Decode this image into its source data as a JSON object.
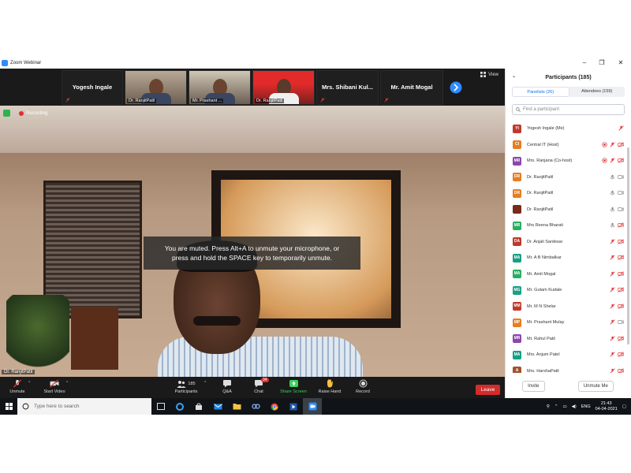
{
  "window": {
    "title": "Zoom Webinar",
    "min": "–",
    "max": "❐",
    "close": "✕"
  },
  "strip": {
    "tiles": [
      {
        "name": "Yogesh Ingale"
      },
      {
        "label": "Dr. RanjitPatil"
      },
      {
        "label": "Mr. Prashant ..."
      },
      {
        "label": "Dr. RanjitPatil"
      },
      {
        "name": "Mrs. Shibani Kul..."
      },
      {
        "name": "Mr. Amit Mogal"
      }
    ],
    "view_label": "View"
  },
  "recording": {
    "label": "Recording"
  },
  "toast": {
    "line1": "You are muted. Press Alt+A to unmute your microphone, or",
    "line2": "press and hold the SPACE key to temporarily unmute."
  },
  "speaker": {
    "name": "Dr. RanjitPatil"
  },
  "toolbar": {
    "unmute": "Unmute",
    "start_video": "Start Video",
    "participants": "Participants",
    "participants_count": "185",
    "qa": "Q&A",
    "chat": "Chat",
    "chat_badge": "34",
    "share_screen": "Share Screen",
    "raise_hand": "Raise Hand",
    "record": "Record",
    "leave": "Leave"
  },
  "panel": {
    "title": "Participants (185)",
    "tabs": [
      "Panelists (26)",
      "Attendees (159)"
    ],
    "search_placeholder": "Find a participant",
    "participants": [
      {
        "initials": "YI",
        "name": "Yogesh Ingale (Me)",
        "color": "#c0392b",
        "icons": "m"
      },
      {
        "initials": "CI",
        "name": "Central IT (Host)",
        "color": "#e67e22",
        "icons": "rmv"
      },
      {
        "initials": "MR",
        "name": "Mrs. Ranjana  (Co-host)",
        "color": "#8e44ad",
        "icons": "rmv"
      },
      {
        "initials": "DR",
        "name": "Dr. RanjitPatil",
        "color": "#e67e22",
        "icons": "MV"
      },
      {
        "initials": "DR",
        "name": "Dr. RanjitPatil",
        "color": "#e67e22",
        "icons": "MV"
      },
      {
        "initials": "",
        "name": "Dr. RanjitPatil",
        "color": "#7a2a1a",
        "icons": "MV"
      },
      {
        "initials": "MR",
        "name": "Mrs Reena Bharati",
        "color": "#27ae60",
        "icons": "Mv"
      },
      {
        "initials": "DA",
        "name": "Dr. Anjali Sardesai",
        "color": "#c0392b",
        "icons": "mv"
      },
      {
        "initials": "MA",
        "name": "Mr. A B Nimbalkar",
        "color": "#16a085",
        "icons": "mv"
      },
      {
        "initials": "MA",
        "name": "Mr. Amit Mogal",
        "color": "#27ae60",
        "icons": "mv"
      },
      {
        "initials": "MG",
        "name": "Mr. Gutam Kudale",
        "color": "#16a085",
        "icons": "mv"
      },
      {
        "initials": "MM",
        "name": "Mr. M N Shelar",
        "color": "#c0392b",
        "icons": "mv"
      },
      {
        "initials": "MP",
        "name": "Mr. Prashant  Mulay",
        "color": "#e67e22",
        "icons": "mV"
      },
      {
        "initials": "MR",
        "name": "Mr. Rahul Patil",
        "color": "#8e44ad",
        "icons": "mv"
      },
      {
        "initials": "MA",
        "name": "Mrs. Anjum Patel",
        "color": "#16a085",
        "icons": "mv"
      },
      {
        "initials": "A",
        "name": "Mrs. HarshaPatil",
        "color": "#a0522d",
        "icons": "mv"
      }
    ],
    "invite": "Invite",
    "unmute_me": "Unmute Me"
  },
  "taskbar": {
    "search_placeholder": "Type here to search",
    "time": "21:43",
    "date": "04-04-2021"
  }
}
